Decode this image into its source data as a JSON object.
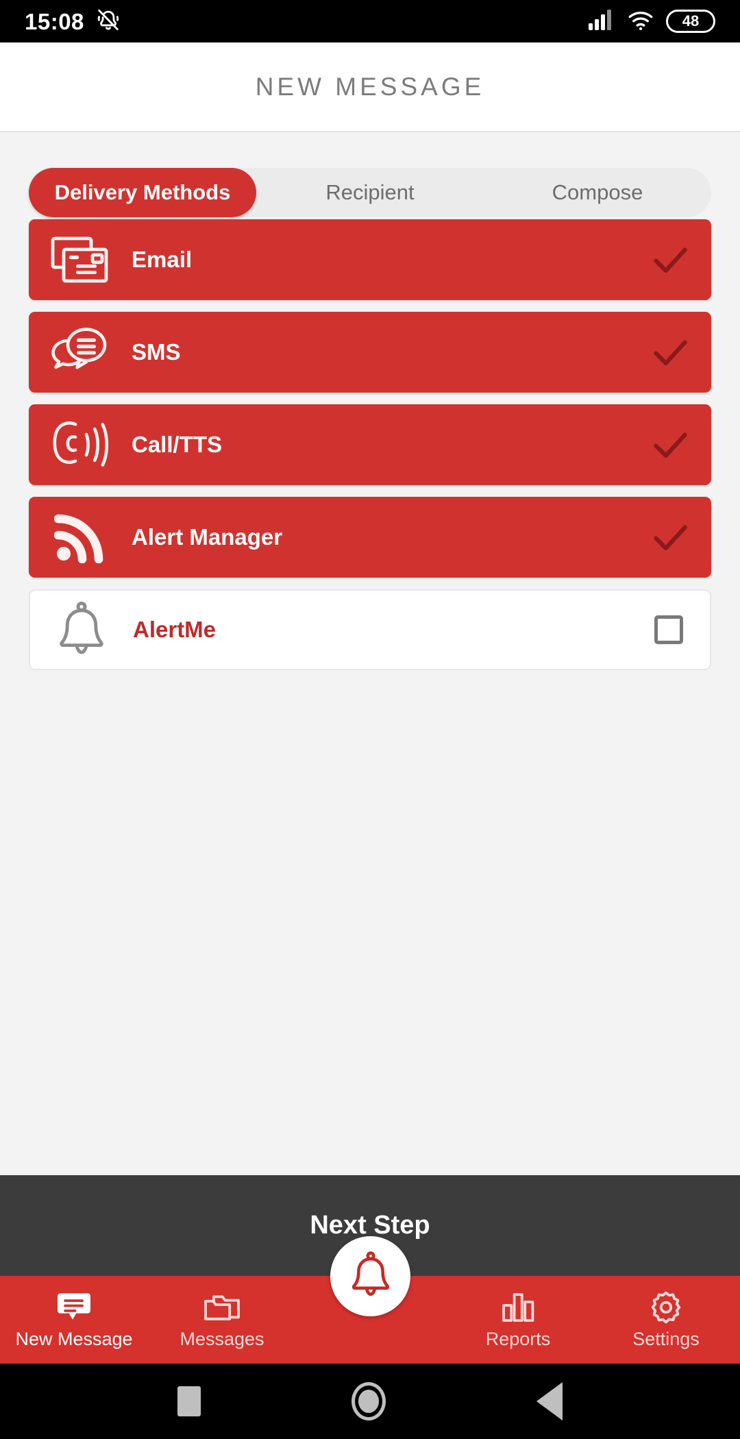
{
  "status_bar": {
    "time": "15:08",
    "ringer_icon": "bell-slash-icon",
    "signal_icon": "cellular-signal-icon",
    "wifi_icon": "wifi-icon",
    "battery_level": "48"
  },
  "header": {
    "title": "NEW MESSAGE",
    "title_color": "#7C7C7C"
  },
  "tabs": [
    {
      "label": "Delivery Methods",
      "active": true
    },
    {
      "label": "Recipient",
      "active": false
    },
    {
      "label": "Compose",
      "active": false
    }
  ],
  "delivery_methods": [
    {
      "label": "Email",
      "icon": "mail-cards-icon",
      "selected": true
    },
    {
      "label": "SMS",
      "icon": "chat-bubbles-icon",
      "selected": true
    },
    {
      "label": "Call/TTS",
      "icon": "phone-waves-icon",
      "selected": true
    },
    {
      "label": "Alert Manager",
      "icon": "broadcast-rss-icon",
      "selected": true
    },
    {
      "label": "AlertMe",
      "icon": "bell-icon",
      "selected": false
    }
  ],
  "next_step": {
    "label": "Next Step"
  },
  "bottom_nav": {
    "items": [
      {
        "label": "New Message",
        "icon": "chat-bubble-icon",
        "active": true
      },
      {
        "label": "Messages",
        "icon": "folders-icon",
        "active": false
      },
      {
        "label": "Reports",
        "icon": "bar-chart-icon",
        "active": false
      },
      {
        "label": "Settings",
        "icon": "gear-icon",
        "active": false
      }
    ],
    "fab_icon": "bell-icon"
  },
  "android_nav": {
    "recents": "square-icon",
    "home": "circle-icon",
    "back": "triangle-back-icon"
  },
  "colors": {
    "brand_red": "#D0332F",
    "nav_red": "#D5312D",
    "dark_bar": "#3D3C3C",
    "check_dark_red": "#8C1A1A",
    "page_bg": "#F3F3F3"
  }
}
